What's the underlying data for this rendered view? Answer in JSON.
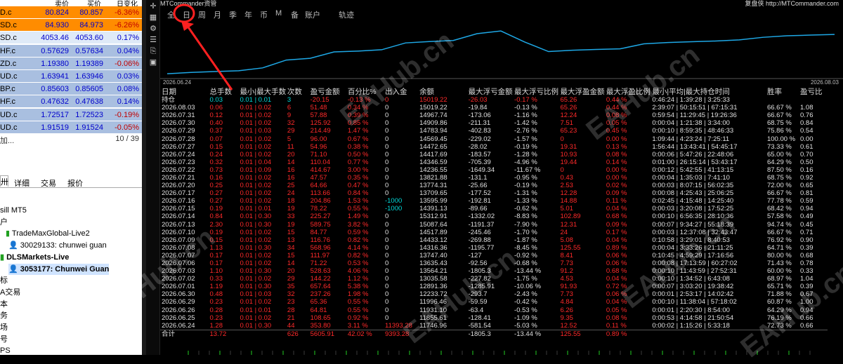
{
  "quotes": {
    "headers": [
      "卖价",
      "买价",
      "日变化"
    ],
    "rows": [
      {
        "sym": "D.c",
        "bid": "80.824",
        "ask": "80.857",
        "chg": "-6.36%",
        "bg": "#ff8c00",
        "chgColor": "#c00000"
      },
      {
        "sym": "SD.c",
        "bid": "84.930",
        "ask": "84.973",
        "chg": "-6.26%",
        "bg": "#ff8c00",
        "chgColor": "#c00000"
      },
      {
        "sym": "SD.c",
        "bid": "4053.46",
        "ask": "4053.60",
        "chg": "0.17%",
        "bg": "#dfeaf7",
        "chgColor": "#0000cc"
      },
      {
        "sym": "HF.c",
        "bid": "0.57629",
        "ask": "0.57634",
        "chg": "0.04%",
        "bg": "#a9bfe0",
        "chgColor": "#0000cc"
      },
      {
        "sym": "ZD.c",
        "bid": "1.19380",
        "ask": "1.19389",
        "chg": "-0.06%",
        "bg": "#a9bfe0",
        "chgColor": "#c00000"
      },
      {
        "sym": "UD.c",
        "bid": "1.63941",
        "ask": "1.63946",
        "chg": "0.03%",
        "bg": "#a9bfe0",
        "chgColor": "#0000cc"
      },
      {
        "sym": "BP.c",
        "bid": "0.85603",
        "ask": "0.85605",
        "chg": "0.08%",
        "bg": "#a9bfe0",
        "chgColor": "#0000cc"
      },
      {
        "sym": "HF.c",
        "bid": "0.47632",
        "ask": "0.47638",
        "chg": "0.14%",
        "bg": "#a9bfe0",
        "chgColor": "#0000cc"
      },
      {
        "sym": "UD.c",
        "bid": "1.72517",
        "ask": "1.72523",
        "chg": "-0.19%",
        "bg": "#a9bfe0",
        "chgColor": "#c00000"
      },
      {
        "sym": "UD.c",
        "bid": "1.91519",
        "ask": "1.91524",
        "chg": "-0.05%",
        "bg": "#a9bfe0",
        "chgColor": "#c00000"
      }
    ],
    "add_label": "加...",
    "count": "10 / 39"
  },
  "nav_tabs": [
    "详细",
    "交易",
    "报价"
  ],
  "navigator": [
    {
      "text": "sill MT5",
      "bold": false
    },
    {
      "text": "户",
      "bold": false
    },
    {
      "text": "TradeMaxGlobal-Live2",
      "bold": false
    },
    {
      "text": "30029133: chunwei guan",
      "bold": false
    },
    {
      "text": "DLSMarkets-Live",
      "bold": true
    },
    {
      "text": "3053177: Chunwei Guan",
      "bold": true
    },
    {
      "text": "标",
      "bold": false
    },
    {
      "text": "A交易",
      "bold": false
    },
    {
      "text": "本",
      "bold": false
    },
    {
      "text": "务",
      "bold": false
    },
    {
      "text": "场",
      "bold": false
    },
    {
      "text": "号",
      "bold": false
    },
    {
      "text": "PS",
      "bold": false
    }
  ],
  "panel": {
    "brand": "MTCommander资管",
    "brand_right": "复盘侠 http://MTCommander.com",
    "nav": [
      "全",
      "日",
      "周",
      "月",
      "季",
      "年",
      "币",
      "M",
      "备",
      "账户",
      "轨迹"
    ],
    "chart_date_start": "2026.06.24",
    "chart_date_end": "2026.08.03"
  },
  "table": {
    "headers": [
      "日期",
      "总手数",
      "最小|最大手数",
      "次数",
      "盈亏金额",
      "百分比%",
      "出入金",
      "余额",
      "最大浮亏金额",
      "最大浮亏比例",
      "最大浮盈金额",
      "最大浮盈比例",
      "最小|平均|最大持仓时间",
      "胜率",
      "盈亏比"
    ],
    "hold": [
      "持仓",
      "0.03",
      "0.01 | 0.01",
      "3",
      "-20.15",
      "-0.13 %",
      "0",
      "15019.22",
      "-26.03",
      "-0.17 %",
      "65.26",
      "0.44 %",
      "0:46:24 | 1:39:28 | 3:25:33",
      "",
      ""
    ],
    "rows": [
      [
        "2026.08.03",
        "0.06",
        "0.01 | 0.02",
        "6",
        "51.48",
        "0.34 %",
        "0",
        "15019.22",
        "-19.84",
        "-0.13 %",
        "65.26",
        "0.44 %",
        "2:39:07 | 50:15:51 | 67:15:31",
        "66.67 %",
        "1.08"
      ],
      [
        "2026.07.31",
        "0.12",
        "0.01 | 0.02",
        "9",
        "57.88",
        "0.39 %",
        "0",
        "14967.74",
        "-173.06",
        "-1.16 %",
        "12.24",
        "0.08 %",
        "0:59:54 | 11:29:45 | 19:26:36",
        "66.67 %",
        "0.76"
      ],
      [
        "2026.07.30",
        "0.40",
        "0.01 | 0.02",
        "32",
        "125.92",
        "0.85 %",
        "0",
        "14909.86",
        "-211.31",
        "-1.42 %",
        "7.51",
        "0.05 %",
        "0:00:04 | 1:21:38 | 3:34:00",
        "68.75 %",
        "0.84"
      ],
      [
        "2026.07.29",
        "0.37",
        "0.01 | 0.03",
        "29",
        "214.49",
        "1.47 %",
        "0",
        "14783.94",
        "-402.83",
        "-2.76 %",
        "65.23",
        "0.45 %",
        "0:00:10 | 8:59:35 | 48:46:33",
        "75.86 %",
        "0.54"
      ],
      [
        "2026.07.28",
        "0.07",
        "0.01 | 0.02",
        "5",
        "96.00",
        "0.67 %",
        "0",
        "14569.45",
        "-229.02",
        "-1.57 %",
        "0",
        "0.00 %",
        "1:09:44 | 4:23:24 | 7:25:11",
        "100.00 %",
        "0.00"
      ],
      [
        "2026.07.27",
        "0.15",
        "0.01 | 0.02",
        "11",
        "54.96",
        "0.38 %",
        "0",
        "14472.65",
        "-28.02",
        "-0.19 %",
        "19.31",
        "0.13 %",
        "1:56:44 | 13:43:41 | 54:45:17",
        "73.33 %",
        "0.61"
      ],
      [
        "2026.07.24",
        "0.24",
        "0.01 | 0.02",
        "20",
        "71.10",
        "0.50 %",
        "0",
        "14417.69",
        "-183.57",
        "-1.28 %",
        "10.93",
        "0.08 %",
        "0:00:06 | 5:47:26 | 22:48:06",
        "65.00 %",
        "0.70"
      ],
      [
        "2026.07.23",
        "0.32",
        "0.01 | 0.04",
        "14",
        "110.04",
        "0.77 %",
        "0",
        "14346.59",
        "-705.39",
        "-4.96 %",
        "19.44",
        "0.14 %",
        "0:01:00 | 26:15:14 | 53:43:17",
        "64.29 %",
        "0.50"
      ],
      [
        "2026.07.22",
        "0.73",
        "0.01 | 0.09",
        "16",
        "414.67",
        "3.00 %",
        "0",
        "14236.55",
        "-1649.34",
        "-11.67 %",
        "0",
        "0.00 %",
        "0:00:12 | 5:42:55 | 41:13:15",
        "87.50 %",
        "0.16"
      ],
      [
        "2026.07.21",
        "0.16",
        "0.01 | 0.02",
        "16",
        "47.57",
        "0.35 %",
        "0",
        "13821.88",
        "-131.1",
        "-0.95 %",
        "0.43",
        "0.00 %",
        "0:00:04 | 1:35:03 | 7:41:10",
        "68.75 %",
        "0.92"
      ],
      [
        "2026.07.20",
        "0.25",
        "0.01 | 0.02",
        "25",
        "64.66",
        "0.47 %",
        "0",
        "13774.31",
        "-25.66",
        "-0.19 %",
        "2.53",
        "0.02 %",
        "0:00:03 | 8:07:15 | 56:02:35",
        "72.00 %",
        "0.65"
      ],
      [
        "2026.07.17",
        "0.27",
        "0.01 | 0.02",
        "24",
        "113.66",
        "0.84 %",
        "0",
        "13709.65",
        "-177.52",
        "-1.31 %",
        "12.28",
        "0.09 %",
        "0:00:08 | 4:25:43 | 25:06:25",
        "66.67 %",
        "0.81"
      ],
      [
        "2026.07.16",
        "0.27",
        "0.01 | 0.02",
        "18",
        "204.86",
        "1.53 %",
        "-1000",
        "13595.99",
        "-192.81",
        "-1.33 %",
        "14.88",
        "0.11 %",
        "0:02:45 | 4:15:48 | 14:25:40",
        "77.78 %",
        "0.59"
      ],
      [
        "2026.07.15",
        "0.19",
        "0.01 | 0.01",
        "19",
        "78.22",
        "0.55 %",
        "-1000",
        "14391.13",
        "-89.66",
        "-0.62 %",
        "5.01",
        "0.04 %",
        "0:00:03 | 3:20:08 | 17:52:25",
        "68.42 %",
        "0.94"
      ],
      [
        "2026.07.14",
        "0.84",
        "0.01 | 0.30",
        "33",
        "225.27",
        "1.49 %",
        "0",
        "15312.91",
        "-1332.02",
        "-8.83 %",
        "102.89",
        "0.68 %",
        "0:00:10 | 6:56:35 | 28:10:36",
        "57.58 %",
        "0.49"
      ],
      [
        "2026.07.13",
        "2.30",
        "0.01 | 0.30",
        "19",
        "589.75",
        "3.82 %",
        "0",
        "15087.64",
        "-1191.37",
        "-7.90 %",
        "12.31",
        "0.09 %",
        "0:00:07 | 9:34:27 | 55:18:39",
        "94.74 %",
        "0.45"
      ],
      [
        "2026.07.10",
        "0.19",
        "0.01 | 0.02",
        "15",
        "84.77",
        "0.59 %",
        "0",
        "14517.89",
        "-245.46",
        "-1.70 %",
        "24",
        "0.17 %",
        "0:00:03 | 12:37:08 | 32:43:47",
        "66.67 %",
        "0.71"
      ],
      [
        "2026.07.09",
        "0.15",
        "0.01 | 0.02",
        "13",
        "116.76",
        "0.82 %",
        "0",
        "14433.12",
        "-269.88",
        "-1.87 %",
        "5.08",
        "0.04 %",
        "0:10:58 | 3:29:01 | 8:40:53",
        "76.92 %",
        "0.90"
      ],
      [
        "2026.07.08",
        "1.13",
        "0.01 | 0.30",
        "34",
        "568.96",
        "4.14 %",
        "0",
        "14316.36",
        "-1195.77",
        "-8.45 %",
        "125.55",
        "0.89 %",
        "0:00:04 | 3:33:26 | 21:11:25",
        "64.71 %",
        "0.39"
      ],
      [
        "2026.07.07",
        "0.17",
        "0.01 | 0.02",
        "15",
        "111.97",
        "0.82 %",
        "0",
        "13747.40",
        "-127",
        "-0.92 %",
        "8.41",
        "0.06 %",
        "0:10:45 | 4:59:29 | 17:16:56",
        "80.00 %",
        "0.68"
      ],
      [
        "2026.07.06",
        "0.17",
        "0.01 | 0.02",
        "14",
        "71.22",
        "0.53 %",
        "0",
        "13635.43",
        "-92.56",
        "-0.68 %",
        "7.73",
        "0.06 %",
        "0:00:08 | 17:13:59 | 60:27:02",
        "71.43 %",
        "0.78"
      ],
      [
        "2026.07.03",
        "1.10",
        "0.01 | 0.30",
        "20",
        "528.63",
        "4.06 %",
        "0",
        "13564.21",
        "-1805.3",
        "-13.44 %",
        "91.2",
        "0.68 %",
        "0:00:10 | 11:43:59 | 27:52:31",
        "60.00 %",
        "0.33"
      ],
      [
        "2026.07.02",
        "0.33",
        "0.01 | 0.02",
        "29",
        "144.22",
        "1.12 %",
        "0",
        "13035.58",
        "-227.82",
        "-1.75 %",
        "4.53",
        "0.04 %",
        "0:00:10 | 1:34:52 | 6:43:08",
        "68.97 %",
        "1.04"
      ],
      [
        "2026.07.01",
        "1.19",
        "0.01 | 0.30",
        "35",
        "657.64",
        "5.38 %",
        "0",
        "12891.36",
        "-1285.91",
        "-10.06 %",
        "91.93",
        "0.72 %",
        "0:00:07 | 3:03:20 | 19:38:42",
        "65.71 %",
        "0.39"
      ],
      [
        "2026.06.30",
        "0.48",
        "0.01 | 0.03",
        "32",
        "237.26",
        "1.98 %",
        "0",
        "12233.72",
        "-293.7",
        "-2.43 %",
        "7.73",
        "0.06 %",
        "0:00:01 | 2:53:17 | 14:02:42",
        "71.88 %",
        "0.67"
      ],
      [
        "2026.06.29",
        "0.23",
        "0.01 | 0.02",
        "23",
        "65.36",
        "0.55 %",
        "0",
        "11996.46",
        "-59.59",
        "-0.42 %",
        "4.84",
        "0.04 %",
        "0:00:10 | 11:38:04 | 57:18:02",
        "60.87 %",
        "1.00"
      ],
      [
        "2026.06.26",
        "0.28",
        "0.01 | 0.01",
        "28",
        "64.81",
        "0.55 %",
        "0",
        "11931.10",
        "-63.4",
        "-0.53 %",
        "6.26",
        "0.05 %",
        "0:00:01 | 2:20:30 | 8:54:00",
        "64.29 %",
        "0.94"
      ],
      [
        "2026.06.25",
        "0.23",
        "0.01 | 0.02",
        "21",
        "108.65",
        "0.92 %",
        "0",
        "11855.61",
        "-128.41",
        "-1.09 %",
        "9.35",
        "0.08 %",
        "0:00:53 | 4:14:58 | 21:50:54",
        "76.19 %",
        "0.66"
      ],
      [
        "2026.06.24",
        "1.28",
        "0.01 | 0.30",
        "44",
        "353.80",
        "3.11 %",
        "11393.28",
        "11746.96",
        "-581.54",
        "-5.03 %",
        "12.52",
        "0.11 %",
        "0:00:02 | 1:15:26 | 5:33:18",
        "72.73 %",
        "0.66"
      ]
    ],
    "total": [
      "合计",
      "13.72",
      "",
      "626",
      "5605.91",
      "42.02 %",
      "9393.28",
      "",
      "-1805.3",
      "-13.44 %",
      "125.55",
      "0.89 %",
      "",
      "",
      ""
    ]
  },
  "watermark": "EAHub.cn",
  "colors": {
    "loss": "#ff2a2a",
    "profit_pos": "#00dada",
    "line": "#1ea8e6"
  }
}
